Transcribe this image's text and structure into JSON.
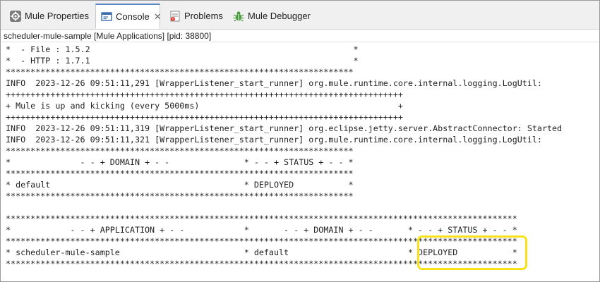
{
  "tabs": [
    {
      "label": "Mule Properties",
      "icon": "gear-icon",
      "active": false
    },
    {
      "label": "Console",
      "icon": "console-icon",
      "active": true,
      "closable": true
    },
    {
      "label": "Problems",
      "icon": "problems-icon",
      "active": false
    },
    {
      "label": "Mule Debugger",
      "icon": "bug-icon",
      "active": false
    }
  ],
  "close_glyph": "✕",
  "console_title": "scheduler-mule-sample [Mule Applications]  [pid: 38800]",
  "console_lines": [
    "*  - File : 1.5.2                                                     *",
    "*  - HTTP : 1.7.1                                                     *",
    "**********************************************************************",
    "INFO  2023-12-26 09:51:11,291 [WrapperListener_start_runner] org.mule.runtime.core.internal.logging.LogUtil:",
    "++++++++++++++++++++++++++++++++++++++++++++++++++++++++++++++++++++++++++++++++",
    "+ Mule is up and kicking (every 5000ms)                                        +",
    "++++++++++++++++++++++++++++++++++++++++++++++++++++++++++++++++++++++++++++++++",
    "INFO  2023-12-26 09:51:11,319 [WrapperListener_start_runner] org.eclipse.jetty.server.AbstractConnector: Started",
    "INFO  2023-12-26 09:51:11,321 [WrapperListener_start_runner] org.mule.runtime.core.internal.logging.LogUtil:",
    "**********************************************************************",
    "*              - - + DOMAIN + - -               * - - + STATUS + - - *",
    "**********************************************************************",
    "* default                                       * DEPLOYED           *",
    "**********************************************************************",
    "",
    "*******************************************************************************************************",
    "*            - - + APPLICATION + - -            *       - - + DOMAIN + - -       * - - + STATUS + - - *",
    "*******************************************************************************************************",
    "* scheduler-mule-sample                         * default                        * DEPLOYED           *",
    "*******************************************************************************************************"
  ],
  "colors": {
    "active_tab_accent": "#5b87c5",
    "highlight": "#f7e21b"
  }
}
